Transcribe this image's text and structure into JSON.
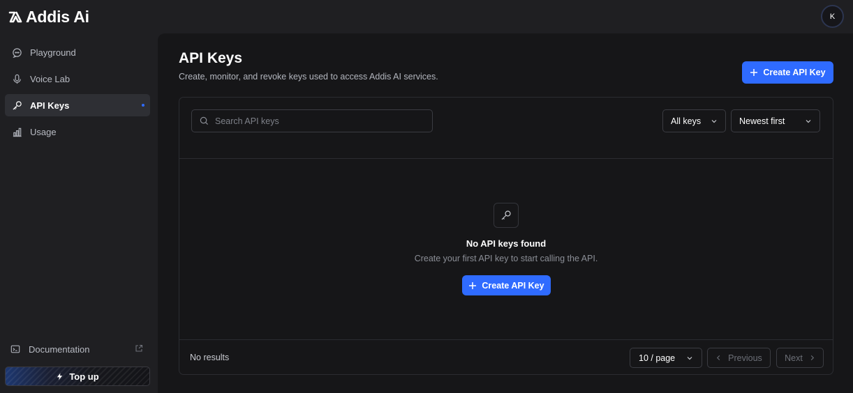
{
  "app": {
    "name": "Addis Ai",
    "user_initial": "K"
  },
  "sidebar": {
    "items": [
      {
        "label": "Playground",
        "icon": "chat-bubble-icon",
        "active": false
      },
      {
        "label": "Voice Lab",
        "icon": "microphone-icon",
        "active": false
      },
      {
        "label": "API Keys",
        "icon": "key-icon",
        "active": true
      },
      {
        "label": "Usage",
        "icon": "bar-chart-icon",
        "active": false
      }
    ],
    "documentation_label": "Documentation",
    "topup_label": "Top up"
  },
  "page": {
    "title": "API Keys",
    "subtitle": "Create, monitor, and revoke keys used to access Addis AI services.",
    "create_button_label": "Create API Key"
  },
  "filters": {
    "search_placeholder": "Search API keys",
    "key_filter": "All keys",
    "sort": "Newest first"
  },
  "empty_state": {
    "title": "No API keys found",
    "description": "Create your first API key to start calling the API.",
    "button_label": "Create API Key"
  },
  "footer": {
    "results_text": "No results",
    "per_page": "10 / page",
    "previous_label": "Previous",
    "next_label": "Next"
  },
  "colors": {
    "accent": "#2f6bff",
    "background": "#1f1f22",
    "main_background": "#161618"
  }
}
